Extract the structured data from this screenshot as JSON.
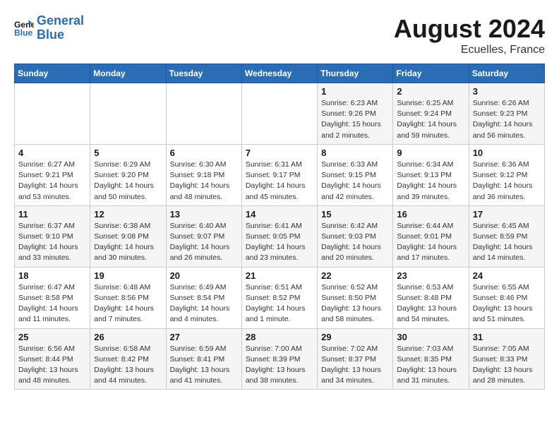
{
  "header": {
    "logo_line1": "General",
    "logo_line2": "Blue",
    "title": "August 2024",
    "subtitle": "Ecuelles, France"
  },
  "days_of_week": [
    "Sunday",
    "Monday",
    "Tuesday",
    "Wednesday",
    "Thursday",
    "Friday",
    "Saturday"
  ],
  "weeks": [
    [
      {
        "num": "",
        "detail": ""
      },
      {
        "num": "",
        "detail": ""
      },
      {
        "num": "",
        "detail": ""
      },
      {
        "num": "",
        "detail": ""
      },
      {
        "num": "1",
        "detail": "Sunrise: 6:23 AM\nSunset: 9:26 PM\nDaylight: 15 hours\nand 2 minutes."
      },
      {
        "num": "2",
        "detail": "Sunrise: 6:25 AM\nSunset: 9:24 PM\nDaylight: 14 hours\nand 59 minutes."
      },
      {
        "num": "3",
        "detail": "Sunrise: 6:26 AM\nSunset: 9:23 PM\nDaylight: 14 hours\nand 56 minutes."
      }
    ],
    [
      {
        "num": "4",
        "detail": "Sunrise: 6:27 AM\nSunset: 9:21 PM\nDaylight: 14 hours\nand 53 minutes."
      },
      {
        "num": "5",
        "detail": "Sunrise: 6:29 AM\nSunset: 9:20 PM\nDaylight: 14 hours\nand 50 minutes."
      },
      {
        "num": "6",
        "detail": "Sunrise: 6:30 AM\nSunset: 9:18 PM\nDaylight: 14 hours\nand 48 minutes."
      },
      {
        "num": "7",
        "detail": "Sunrise: 6:31 AM\nSunset: 9:17 PM\nDaylight: 14 hours\nand 45 minutes."
      },
      {
        "num": "8",
        "detail": "Sunrise: 6:33 AM\nSunset: 9:15 PM\nDaylight: 14 hours\nand 42 minutes."
      },
      {
        "num": "9",
        "detail": "Sunrise: 6:34 AM\nSunset: 9:13 PM\nDaylight: 14 hours\nand 39 minutes."
      },
      {
        "num": "10",
        "detail": "Sunrise: 6:36 AM\nSunset: 9:12 PM\nDaylight: 14 hours\nand 36 minutes."
      }
    ],
    [
      {
        "num": "11",
        "detail": "Sunrise: 6:37 AM\nSunset: 9:10 PM\nDaylight: 14 hours\nand 33 minutes."
      },
      {
        "num": "12",
        "detail": "Sunrise: 6:38 AM\nSunset: 9:08 PM\nDaylight: 14 hours\nand 30 minutes."
      },
      {
        "num": "13",
        "detail": "Sunrise: 6:40 AM\nSunset: 9:07 PM\nDaylight: 14 hours\nand 26 minutes."
      },
      {
        "num": "14",
        "detail": "Sunrise: 6:41 AM\nSunset: 9:05 PM\nDaylight: 14 hours\nand 23 minutes."
      },
      {
        "num": "15",
        "detail": "Sunrise: 6:42 AM\nSunset: 9:03 PM\nDaylight: 14 hours\nand 20 minutes."
      },
      {
        "num": "16",
        "detail": "Sunrise: 6:44 AM\nSunset: 9:01 PM\nDaylight: 14 hours\nand 17 minutes."
      },
      {
        "num": "17",
        "detail": "Sunrise: 6:45 AM\nSunset: 8:59 PM\nDaylight: 14 hours\nand 14 minutes."
      }
    ],
    [
      {
        "num": "18",
        "detail": "Sunrise: 6:47 AM\nSunset: 8:58 PM\nDaylight: 14 hours\nand 11 minutes."
      },
      {
        "num": "19",
        "detail": "Sunrise: 6:48 AM\nSunset: 8:56 PM\nDaylight: 14 hours\nand 7 minutes."
      },
      {
        "num": "20",
        "detail": "Sunrise: 6:49 AM\nSunset: 8:54 PM\nDaylight: 14 hours\nand 4 minutes."
      },
      {
        "num": "21",
        "detail": "Sunrise: 6:51 AM\nSunset: 8:52 PM\nDaylight: 14 hours\nand 1 minute."
      },
      {
        "num": "22",
        "detail": "Sunrise: 6:52 AM\nSunset: 8:50 PM\nDaylight: 13 hours\nand 58 minutes."
      },
      {
        "num": "23",
        "detail": "Sunrise: 6:53 AM\nSunset: 8:48 PM\nDaylight: 13 hours\nand 54 minutes."
      },
      {
        "num": "24",
        "detail": "Sunrise: 6:55 AM\nSunset: 8:46 PM\nDaylight: 13 hours\nand 51 minutes."
      }
    ],
    [
      {
        "num": "25",
        "detail": "Sunrise: 6:56 AM\nSunset: 8:44 PM\nDaylight: 13 hours\nand 48 minutes."
      },
      {
        "num": "26",
        "detail": "Sunrise: 6:58 AM\nSunset: 8:42 PM\nDaylight: 13 hours\nand 44 minutes."
      },
      {
        "num": "27",
        "detail": "Sunrise: 6:59 AM\nSunset: 8:41 PM\nDaylight: 13 hours\nand 41 minutes."
      },
      {
        "num": "28",
        "detail": "Sunrise: 7:00 AM\nSunset: 8:39 PM\nDaylight: 13 hours\nand 38 minutes."
      },
      {
        "num": "29",
        "detail": "Sunrise: 7:02 AM\nSunset: 8:37 PM\nDaylight: 13 hours\nand 34 minutes."
      },
      {
        "num": "30",
        "detail": "Sunrise: 7:03 AM\nSunset: 8:35 PM\nDaylight: 13 hours\nand 31 minutes."
      },
      {
        "num": "31",
        "detail": "Sunrise: 7:05 AM\nSunset: 8:33 PM\nDaylight: 13 hours\nand 28 minutes."
      }
    ]
  ]
}
